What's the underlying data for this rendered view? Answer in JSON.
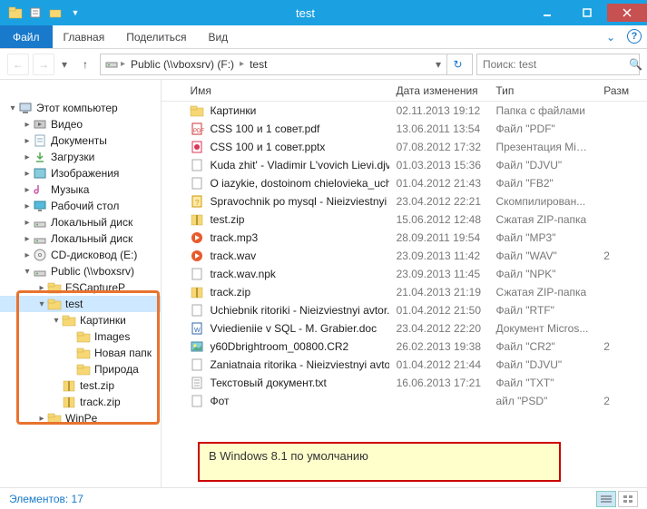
{
  "title": "test",
  "ribbon": {
    "file": "Файл",
    "tabs": [
      "Главная",
      "Поделиться",
      "Вид"
    ]
  },
  "breadcrumb": [
    "Public (\\\\vboxsrv) (F:)",
    "test"
  ],
  "search_placeholder": "Поиск: test",
  "columns": {
    "name": "Имя",
    "date": "Дата изменения",
    "type": "Тип",
    "size": "Разм"
  },
  "tree": [
    {
      "indent": 0,
      "exp": "▾",
      "icon": "computer",
      "label": "Этот компьютер"
    },
    {
      "indent": 1,
      "exp": "▸",
      "icon": "video",
      "label": "Видео"
    },
    {
      "indent": 1,
      "exp": "▸",
      "icon": "docs",
      "label": "Документы"
    },
    {
      "indent": 1,
      "exp": "▸",
      "icon": "downloads",
      "label": "Загрузки"
    },
    {
      "indent": 1,
      "exp": "▸",
      "icon": "pictures",
      "label": "Изображения"
    },
    {
      "indent": 1,
      "exp": "▸",
      "icon": "music",
      "label": "Музыка"
    },
    {
      "indent": 1,
      "exp": "▸",
      "icon": "desktop",
      "label": "Рабочий стол"
    },
    {
      "indent": 1,
      "exp": "▸",
      "icon": "drive",
      "label": "Локальный диск"
    },
    {
      "indent": 1,
      "exp": "▸",
      "icon": "drive",
      "label": "Локальный диск"
    },
    {
      "indent": 1,
      "exp": "▸",
      "icon": "cd",
      "label": "CD-дисковод (E:)"
    },
    {
      "indent": 1,
      "exp": "▾",
      "icon": "netdrive",
      "label": "Public (\\\\vboxsrv)"
    },
    {
      "indent": 2,
      "exp": "▸",
      "icon": "folder",
      "label": "FSCaptureP"
    },
    {
      "indent": 2,
      "exp": "▾",
      "icon": "folder-open",
      "label": "test",
      "selected": true
    },
    {
      "indent": 3,
      "exp": "▾",
      "icon": "folder",
      "label": "Картинки"
    },
    {
      "indent": 4,
      "exp": "",
      "icon": "folder",
      "label": "Images"
    },
    {
      "indent": 4,
      "exp": "",
      "icon": "folder",
      "label": "Новая папк"
    },
    {
      "indent": 4,
      "exp": "",
      "icon": "folder",
      "label": "Природа"
    },
    {
      "indent": 3,
      "exp": "",
      "icon": "zip",
      "label": "test.zip"
    },
    {
      "indent": 3,
      "exp": "",
      "icon": "zip",
      "label": "track.zip"
    },
    {
      "indent": 2,
      "exp": "▸",
      "icon": "folder",
      "label": "WinPe"
    }
  ],
  "files": [
    {
      "icon": "folder",
      "name": "Картинки",
      "date": "02.11.2013 19:12",
      "type": "Папка с файлами",
      "size": ""
    },
    {
      "icon": "pdf",
      "name": "CSS 100 и 1 совет.pdf",
      "date": "13.06.2011 13:54",
      "type": "Файл \"PDF\"",
      "size": ""
    },
    {
      "icon": "pptx",
      "name": "CSS 100 и 1 совет.pptx",
      "date": "07.08.2012 17:32",
      "type": "Презентация Mic...",
      "size": ""
    },
    {
      "icon": "file",
      "name": "Kuda zhit' - Vladimir L'vovich Lievi.djvu",
      "date": "01.03.2013 15:36",
      "type": "Файл \"DJVU\"",
      "size": ""
    },
    {
      "icon": "file",
      "name": "O iazykie, dostoinom chielovieka_uchieb...",
      "date": "01.04.2012 21:43",
      "type": "Файл \"FB2\"",
      "size": ""
    },
    {
      "icon": "chm",
      "name": "Spravochnik po mysql - Nieizviestnyi avt...",
      "date": "23.04.2012 22:21",
      "type": "Скомпилирован...",
      "size": ""
    },
    {
      "icon": "zip",
      "name": "test.zip",
      "date": "15.06.2012 12:48",
      "type": "Сжатая ZIP-папка",
      "size": ""
    },
    {
      "icon": "audio",
      "name": "track.mp3",
      "date": "28.09.2011 19:54",
      "type": "Файл \"MP3\"",
      "size": ""
    },
    {
      "icon": "audio",
      "name": "track.wav",
      "date": "23.09.2013 11:42",
      "type": "Файл \"WAV\"",
      "size": "2"
    },
    {
      "icon": "file",
      "name": "track.wav.npk",
      "date": "23.09.2013 11:45",
      "type": "Файл \"NPK\"",
      "size": ""
    },
    {
      "icon": "zip",
      "name": "track.zip",
      "date": "21.04.2013 21:19",
      "type": "Сжатая ZIP-папка",
      "size": ""
    },
    {
      "icon": "file",
      "name": "Uchiebnik ritoriki - Nieizviestnyi avtor.rtf",
      "date": "01.04.2012 21:50",
      "type": "Файл \"RTF\"",
      "size": ""
    },
    {
      "icon": "doc",
      "name": "Vviedieniie v SQL - M. Grabier.doc",
      "date": "23.04.2012 22:20",
      "type": "Документ Micros...",
      "size": ""
    },
    {
      "icon": "img",
      "name": "y60Dbrightroom_00800.CR2",
      "date": "26.02.2013 19:38",
      "type": "Файл \"CR2\"",
      "size": "2"
    },
    {
      "icon": "file",
      "name": "Zaniatnaia ritorika - Nieizviestnyi avtor.dj...",
      "date": "01.04.2012 21:44",
      "type": "Файл \"DJVU\"",
      "size": ""
    },
    {
      "icon": "txt",
      "name": "Текстовый документ.txt",
      "date": "16.06.2013 17:21",
      "type": "Файл \"TXT\"",
      "size": ""
    },
    {
      "icon": "file",
      "name": "Фот",
      "date": "",
      "type": "айл \"PSD\"",
      "size": "2"
    }
  ],
  "callout": "В Windows 8.1 по умолчанию",
  "status": {
    "text": "Элементов: 17"
  }
}
